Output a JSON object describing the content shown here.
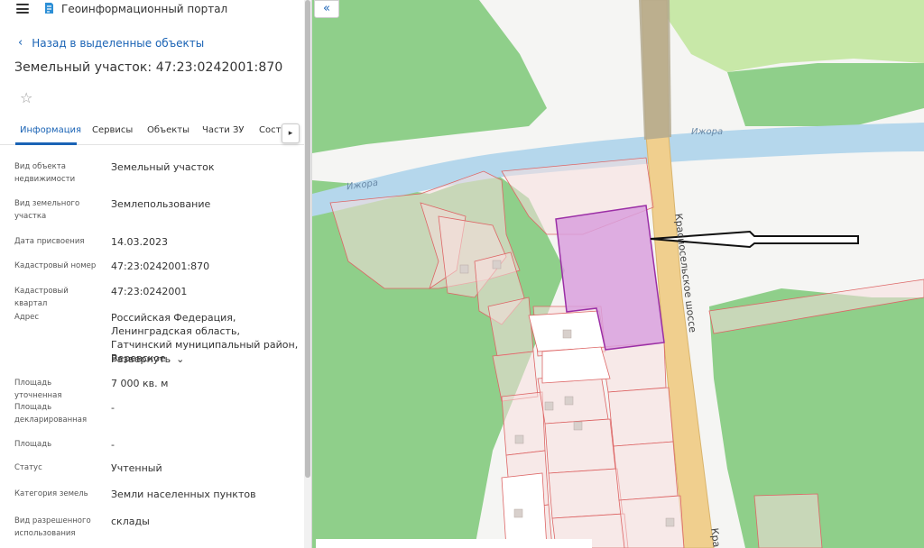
{
  "app": {
    "title": "Геоинформационный портал"
  },
  "nav": {
    "back_label": "Назад в выделенные объекты"
  },
  "object": {
    "title": "Земельный участок: 47:23:0242001:870"
  },
  "tabs": [
    {
      "label": "Информация",
      "active": true
    },
    {
      "label": "Сервисы",
      "active": false
    },
    {
      "label": "Объекты",
      "active": false
    },
    {
      "label": "Части ЗУ",
      "active": false
    },
    {
      "label": "Соста",
      "active": false
    }
  ],
  "properties": [
    {
      "label": "Вид объекта недвижимости",
      "value": "Земельный участок"
    },
    {
      "label": "Вид земельного участка",
      "value": "Землепользование"
    },
    {
      "label": "Дата присвоения",
      "value": "14.03.2023"
    },
    {
      "label": "Кадастровый номер",
      "value": "47:23:0242001:870"
    },
    {
      "label": "Кадастровый квартал",
      "value": "47:23:0242001"
    },
    {
      "label": "Адрес",
      "value": "Российская Федерация, Ленинградская область, Гатчинский муниципальный район, Веревское",
      "expand_label": "Развернуть"
    },
    {
      "label": "Площадь уточненная",
      "value": "7 000 кв. м"
    },
    {
      "label": "Площадь декларированная",
      "value": "-"
    },
    {
      "label": "Площадь",
      "value": "-"
    },
    {
      "label": "Статус",
      "value": "Учтенный"
    },
    {
      "label": "Категория земель",
      "value": "Земли населенных пунктов"
    },
    {
      "label": "Вид разрешенного использования",
      "value": "склады"
    }
  ],
  "map": {
    "river_label_1": "Ижора",
    "river_label_2": "Ижора",
    "road_label": "Красносельское шоссе",
    "road_label_bottom": "Кра",
    "colors": {
      "green": "#7fc97f",
      "water": "#aed3ea",
      "road": "#f2d39b",
      "parcel": "#e8a3a3",
      "selected": "#d9a0dd",
      "selected_border": "#9b2fa6",
      "accent": "#1a63b5"
    }
  }
}
